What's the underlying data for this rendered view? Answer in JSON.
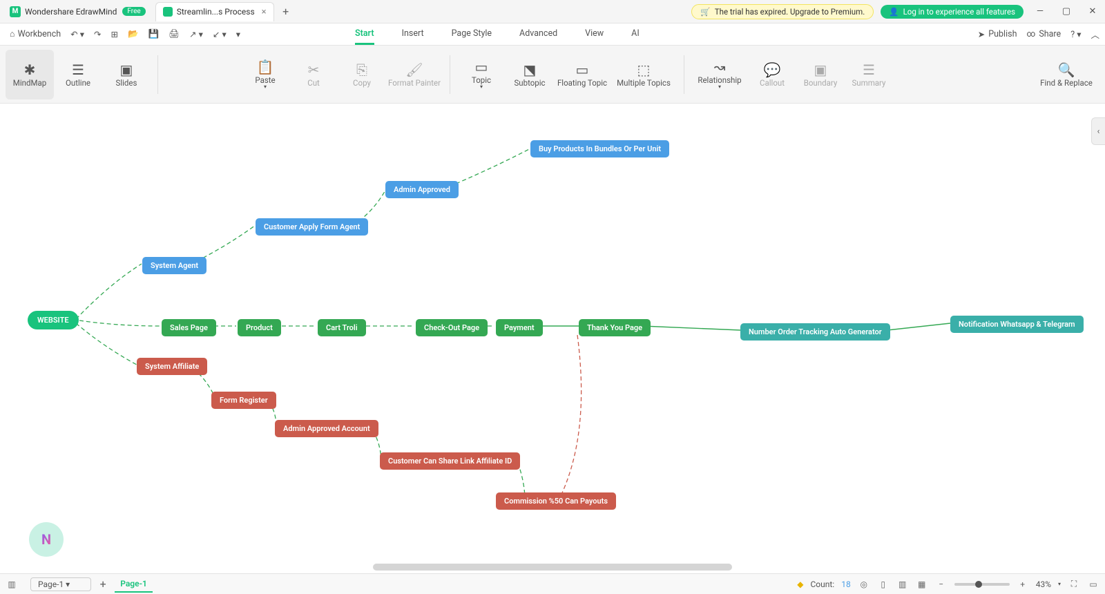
{
  "title_bar": {
    "app_name": "Wondershare EdrawMind",
    "free_badge": "Free",
    "file_tab": "Streamlin...s Process",
    "trial_banner": "The trial has expired. Upgrade to Premium.",
    "login_banner": "Log in to experience all features"
  },
  "menu": {
    "workbench": "Workbench",
    "tabs": [
      "Start",
      "Insert",
      "Page Style",
      "Advanced",
      "View",
      "AI"
    ],
    "active_tab": "Start",
    "publish": "Publish",
    "share": "Share"
  },
  "ribbon": {
    "mindmap": "MindMap",
    "outline": "Outline",
    "slides": "Slides",
    "paste": "Paste",
    "cut": "Cut",
    "copy": "Copy",
    "format_painter": "Format Painter",
    "topic": "Topic",
    "subtopic": "Subtopic",
    "floating": "Floating Topic",
    "multiple": "Multiple Topics",
    "relationship": "Relationship",
    "callout": "Callout",
    "boundary": "Boundary",
    "summary": "Summary",
    "find_replace": "Find & Replace"
  },
  "nodes": {
    "root": "WEBSITE",
    "system_agent": "System Agent",
    "customer_apply": "Customer Apply Form Agent",
    "admin_approved": "Admin Approved",
    "buy_products": "Buy Products In Bundles Or Per Unit",
    "sales_page": "Sales Page",
    "product": "Product",
    "cart": "Cart Troli",
    "checkout": "Check-Out Page",
    "payment": "Payment",
    "thankyou": "Thank You Page",
    "tracking": "Number Order Tracking Auto Generator",
    "notification": "Notification Whatsapp & Telegram",
    "system_affiliate": "System Affiliate",
    "form_register": "Form Register",
    "admin_approved_account": "Admin Approved Account",
    "share_link": "Customer Can Share Link Affiliate ID",
    "commission": "Commission %50 Can Payouts"
  },
  "status": {
    "page_dropdown": "Page-1",
    "active_page": "Page-1",
    "count_label": "Count:",
    "count_value": "18",
    "zoom": "43%"
  }
}
